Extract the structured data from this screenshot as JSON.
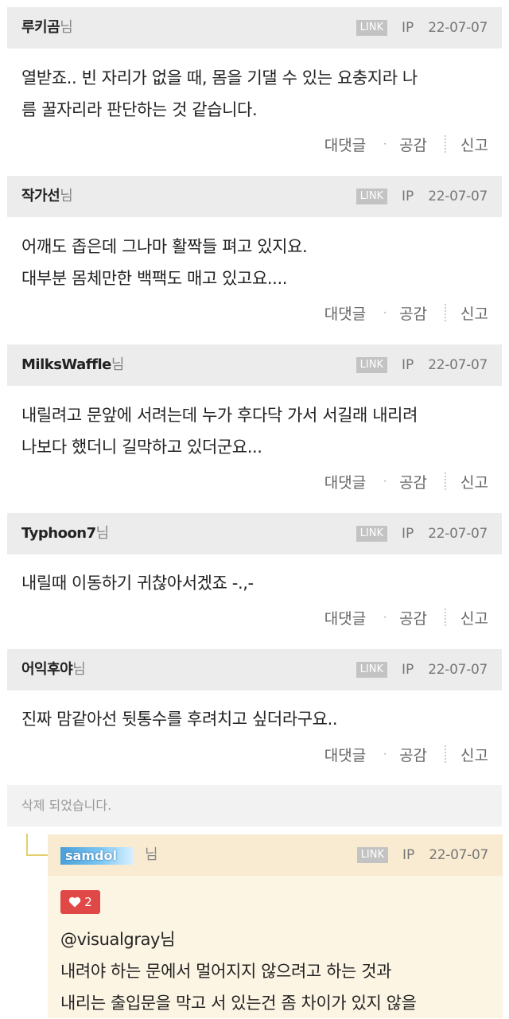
{
  "comments": [
    {
      "name": "루키곰",
      "suffix": "님",
      "link": "LINK",
      "ip": "IP",
      "date": "22-07-07",
      "lines": [
        "열받죠.. 빈 자리가 없을 때, 몸을 기댈 수 있는 요충지라 나",
        "름 꿀자리라 판단하는 것 같습니다."
      ],
      "reply": "대댓글",
      "dot": "·",
      "like": "공감",
      "report": "신고"
    },
    {
      "name": "작가선",
      "suffix": "님",
      "link": "LINK",
      "ip": "IP",
      "date": "22-07-07",
      "lines": [
        "어깨도 좁은데 그나마 활짝들 펴고 있지요.",
        "대부분 몸체만한 백팩도 매고 있고요...."
      ],
      "reply": "대댓글",
      "dot": "·",
      "like": "공감",
      "report": "신고"
    },
    {
      "name": "MilksWaffle",
      "suffix": "님",
      "link": "LINK",
      "ip": "IP",
      "date": "22-07-07",
      "lines": [
        "내릴려고 문앞에 서려는데 누가 후다닥 가서 서길래 내리려",
        "나보다 했더니 길막하고 있더군요..."
      ],
      "reply": "대댓글",
      "dot": "·",
      "like": "공감",
      "report": "신고"
    },
    {
      "name": "Typhoon7",
      "suffix": "님",
      "link": "LINK",
      "ip": "IP",
      "date": "22-07-07",
      "lines": [
        "내릴때 이동하기 귀찮아서겠죠 -.,-"
      ],
      "reply": "대댓글",
      "dot": "·",
      "like": "공감",
      "report": "신고"
    },
    {
      "name": "어익후야",
      "suffix": "님",
      "link": "LINK",
      "ip": "IP",
      "date": "22-07-07",
      "lines": [
        "진짜 맘같아선 뒷통수를 후려치고 싶더라구요.."
      ],
      "reply": "대댓글",
      "dot": "·",
      "like": "공감",
      "report": "신고"
    }
  ],
  "deleted_text": "삭제 되었습니다.",
  "reply_comment": {
    "name": "samdol",
    "suffix": "님",
    "link": "LINK",
    "ip": "IP",
    "date": "22-07-07",
    "like_count": "2",
    "lines": [
      "@visualgray님",
      "내려야 하는 문에서 멀어지지 않으려고 하는 것과",
      "내리는 출입문을 막고 서 있는건 좀 차이가 있지 않을"
    ]
  },
  "colors": {
    "header_bg": "#ececec",
    "reply_head_bg": "#f9ebd1",
    "reply_bg": "#fdf5e4",
    "like_badge": "#e04848",
    "link_badge": "#c3c3c3"
  }
}
